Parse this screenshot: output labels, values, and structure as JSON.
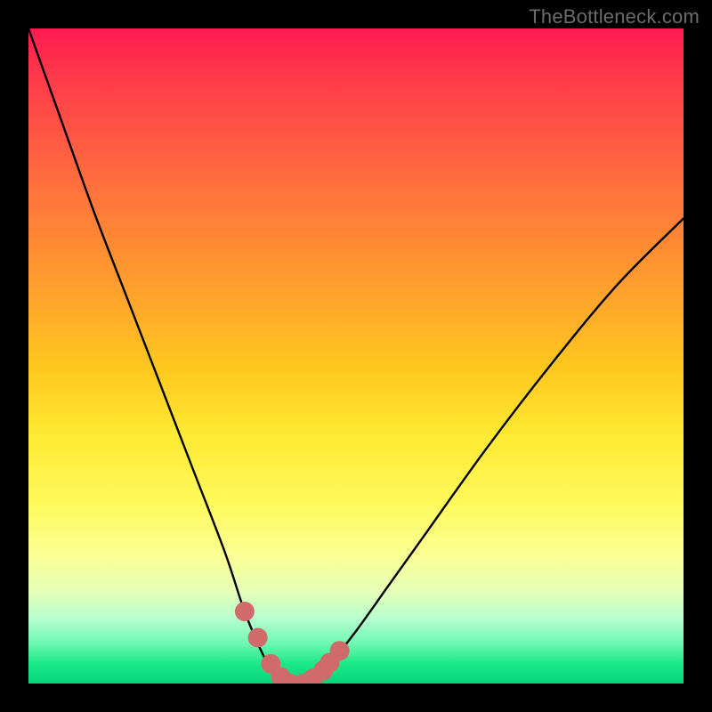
{
  "watermark": "TheBottleneck.com",
  "chart_data": {
    "type": "line",
    "title": "",
    "xlabel": "",
    "ylabel": "",
    "xlim": [
      0,
      100
    ],
    "ylim": [
      0,
      100
    ],
    "series": [
      {
        "name": "bottleneck-curve",
        "x": [
          0,
          5,
          10,
          15,
          20,
          25,
          30,
          33,
          36,
          38,
          40,
          42,
          44,
          46,
          50,
          55,
          60,
          70,
          80,
          90,
          100
        ],
        "values": [
          100,
          86,
          72,
          59,
          46,
          33,
          20,
          11,
          4,
          1,
          0,
          0,
          1,
          3,
          8,
          15,
          22,
          36,
          49,
          61,
          71
        ]
      }
    ],
    "markers": {
      "name": "highlight-dots",
      "color": "#d16a6a",
      "x": [
        33,
        35,
        37,
        38.5,
        40,
        42,
        43.5,
        45,
        46,
        47.5
      ],
      "values": [
        11,
        7,
        3,
        1,
        0,
        0,
        0.8,
        2,
        3.2,
        5
      ]
    },
    "gradient_stops": [
      {
        "pos": 0,
        "color": "#ff1a52"
      },
      {
        "pos": 50,
        "color": "#ffd22a"
      },
      {
        "pos": 80,
        "color": "#fcffa0"
      },
      {
        "pos": 100,
        "color": "#05d47a"
      }
    ]
  }
}
